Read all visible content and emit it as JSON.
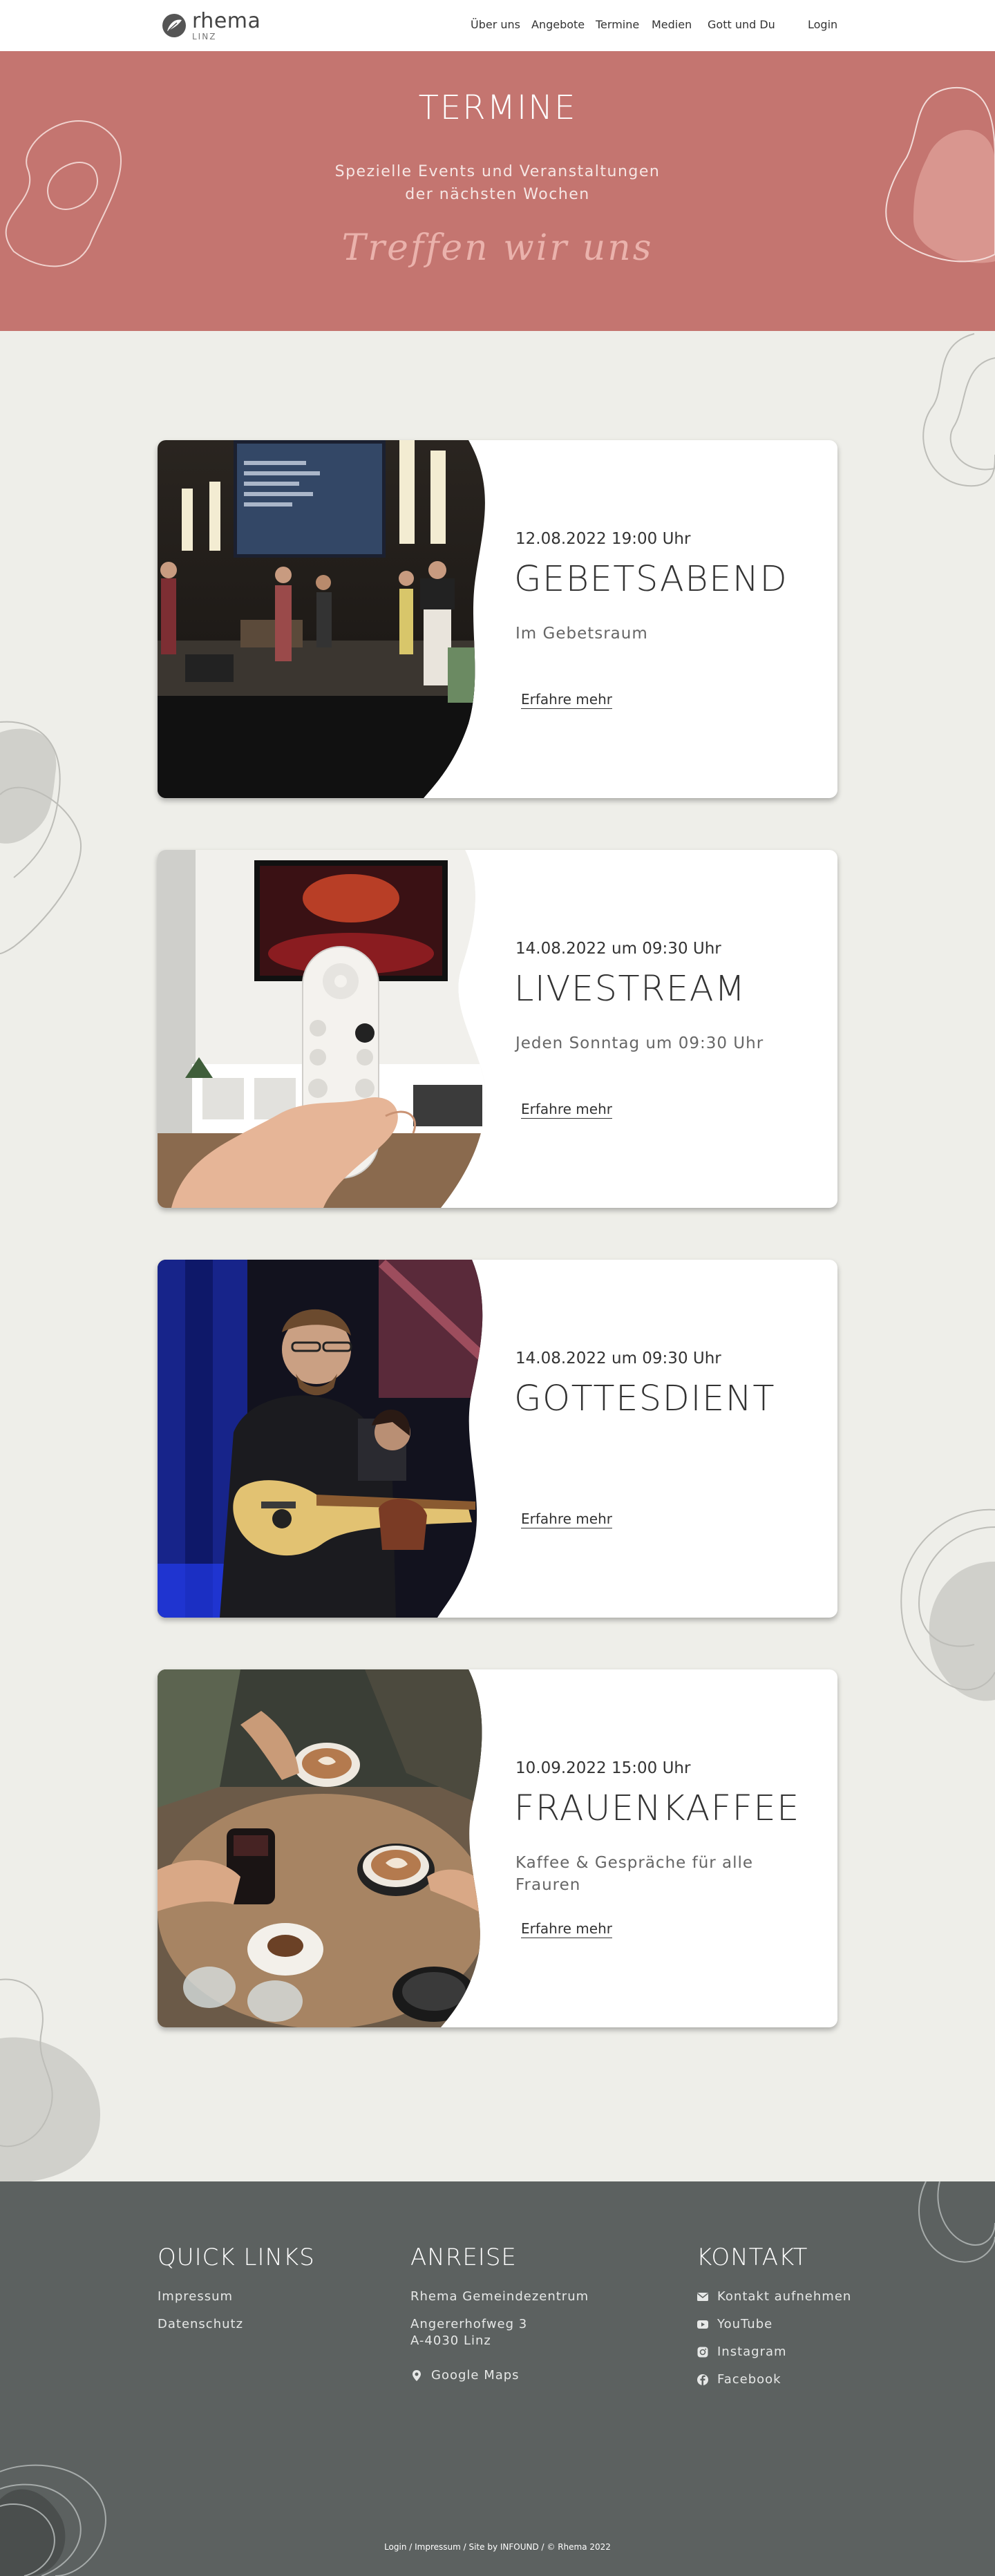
{
  "header": {
    "logo": {
      "name": "rhema",
      "city": "LINZ"
    },
    "nav": [
      {
        "label": "Über uns"
      },
      {
        "label": "Angebote"
      },
      {
        "label": "Termine"
      },
      {
        "label": "Medien"
      },
      {
        "label": "Gott und Du"
      },
      {
        "label": "Login"
      }
    ]
  },
  "hero": {
    "title": "TERMINE",
    "subtitle_line1": "Spezielle Events und Veranstaltungen",
    "subtitle_line2": "der nächsten Wochen",
    "script_text": "Treffen wir uns",
    "background_color": "#c47570"
  },
  "events": [
    {
      "date": "12.08.2022  19:00 Uhr",
      "title": "GEBETSABEND",
      "description": "Im Gebetsraum",
      "link": "Erfahre mehr",
      "image": "church-stage-worship-band"
    },
    {
      "date": "14.08.2022  um 09:30 Uhr",
      "title": "LIVESTREAM",
      "description": "Jeden Sonntag um 09:30 Uhr",
      "link": "Erfahre mehr",
      "image": "hand-holding-tv-remote"
    },
    {
      "date": "14.08.2022  um 09:30 Uhr",
      "title": "GOTTESDIENT",
      "description": "",
      "link": "Erfahre mehr",
      "image": "guitarist-on-stage"
    },
    {
      "date": "10.09.2022  15:00 Uhr",
      "title": "FRAUENKAFFEE",
      "description": "Kaffee & Gespräche für alle Frauren",
      "link": "Erfahre mehr",
      "image": "coffee-cups-table"
    }
  ],
  "footer": {
    "quick_links": {
      "heading": "QUICK LINKS",
      "items": [
        "Impressum",
        "Datenschutz"
      ]
    },
    "anreise": {
      "heading": "ANREISE",
      "venue": "Rhema Gemeindezentrum",
      "street": "Angererhofweg 3",
      "city": "A-4030 Linz",
      "maps_link": "Google Maps"
    },
    "kontakt": {
      "heading": "KONTAKT",
      "items": [
        {
          "label": "Kontakt aufnehmen",
          "icon": "envelope-icon"
        },
        {
          "label": "YouTube",
          "icon": "youtube-icon"
        },
        {
          "label": "Instagram",
          "icon": "instagram-icon"
        },
        {
          "label": "Facebook",
          "icon": "facebook-icon"
        }
      ]
    },
    "bottom_text": "Login / Impressum / Site by INFOUND / © Rhema 2022",
    "background_color": "#5c6160"
  }
}
